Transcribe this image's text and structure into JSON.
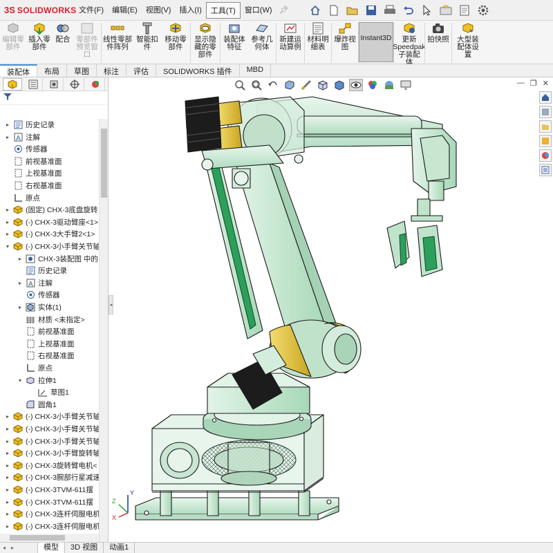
{
  "app": {
    "logo_ds": "3S",
    "logo_name": "SOLIDWORKS"
  },
  "menu": [
    "文件(F)",
    "编辑(E)",
    "视图(V)",
    "插入(I)",
    "工具(T)",
    "窗口(W)"
  ],
  "menu_active_index": 4,
  "ribbon": [
    {
      "label": "编辑零\n部件",
      "icon": "edit-component-icon",
      "disabled": true
    },
    {
      "label": "插入零\n部件",
      "icon": "insert-component-icon",
      "disabled": false
    },
    {
      "label": "配合",
      "icon": "mate-icon",
      "disabled": false
    },
    {
      "label": "零部件\n预览窗\n口",
      "icon": "component-preview-icon",
      "disabled": true
    },
    {
      "label": "线性零部\n件阵列",
      "icon": "linear-pattern-icon",
      "disabled": false
    },
    {
      "label": "智能扣\n件",
      "icon": "smart-fastener-icon",
      "disabled": false
    },
    {
      "label": "移动零\n部件",
      "icon": "move-component-icon",
      "disabled": false
    },
    {
      "label": "显示隐\n藏的零\n部件",
      "icon": "show-hidden-icon",
      "disabled": false
    },
    {
      "label": "装配体\n特征",
      "icon": "assembly-feature-icon",
      "disabled": false
    },
    {
      "label": "参考几\n何体",
      "icon": "reference-geometry-icon",
      "disabled": false
    },
    {
      "label": "新建运\n动算例",
      "icon": "motion-study-icon",
      "disabled": false
    },
    {
      "label": "材料明\n细表",
      "icon": "bom-icon",
      "disabled": false
    },
    {
      "label": "爆炸视\n图",
      "icon": "exploded-view-icon",
      "disabled": false
    },
    {
      "label": "Instant3D",
      "icon": "instant3d-icon",
      "disabled": false
    },
    {
      "label": "更新\nSpeedpak\n子装配\n体",
      "icon": "speedpak-icon",
      "disabled": false
    },
    {
      "label": "拍快照",
      "icon": "snapshot-icon",
      "disabled": false
    },
    {
      "label": "大型装\n配体设\n置",
      "icon": "large-assembly-icon",
      "disabled": false
    }
  ],
  "cm_tabs": [
    "装配体",
    "布局",
    "草图",
    "标注",
    "评估",
    "SOLIDWORKS 插件",
    "MBD"
  ],
  "cm_active_index": 0,
  "tree": [
    {
      "label": "历史记录",
      "icon": "history-icon",
      "exp": "▸",
      "indent": 0
    },
    {
      "label": "注解",
      "icon": "annotation-icon",
      "exp": "▸",
      "indent": 0
    },
    {
      "label": "传感器",
      "icon": "sensor-icon",
      "exp": "",
      "indent": 0
    },
    {
      "label": "前视基准面",
      "icon": "plane-icon",
      "exp": "",
      "indent": 0
    },
    {
      "label": "上视基准面",
      "icon": "plane-icon",
      "exp": "",
      "indent": 0
    },
    {
      "label": "右视基准面",
      "icon": "plane-icon",
      "exp": "",
      "indent": 0
    },
    {
      "label": "原点",
      "icon": "origin-icon",
      "exp": "",
      "indent": 0
    },
    {
      "label": "(固定) CHX-3底盘旋转",
      "icon": "part-icon",
      "exp": "▸",
      "indent": 0
    },
    {
      "label": "(-) CHX-3驱动臂座<1>",
      "icon": "part-icon",
      "exp": "▸",
      "indent": 0
    },
    {
      "label": "(-) CHX-3大手臂2<1>",
      "icon": "part-icon",
      "exp": "▸",
      "indent": 0
    },
    {
      "label": "(-) CHX-3小手臂关节轴",
      "icon": "part-icon",
      "exp": "▾",
      "indent": 0
    },
    {
      "label": "CHX-3装配图 中的",
      "icon": "assembly-icon",
      "exp": "▸",
      "indent": 1
    },
    {
      "label": "历史记录",
      "icon": "history-icon",
      "exp": "",
      "indent": 1
    },
    {
      "label": "注解",
      "icon": "annotation-icon",
      "exp": "▸",
      "indent": 1
    },
    {
      "label": "传感器",
      "icon": "sensor-icon",
      "exp": "",
      "indent": 1
    },
    {
      "label": "实体(1)",
      "icon": "solid-body-icon",
      "exp": "▸",
      "indent": 1
    },
    {
      "label": "材质 <未指定>",
      "icon": "material-icon",
      "exp": "",
      "indent": 1
    },
    {
      "label": "前视基准面",
      "icon": "plane-icon",
      "exp": "",
      "indent": 1
    },
    {
      "label": "上视基准面",
      "icon": "plane-icon",
      "exp": "",
      "indent": 1
    },
    {
      "label": "右视基准面",
      "icon": "plane-icon",
      "exp": "",
      "indent": 1
    },
    {
      "label": "原点",
      "icon": "origin-icon",
      "exp": "",
      "indent": 1
    },
    {
      "label": "拉伸1",
      "icon": "extrude-icon",
      "exp": "▾",
      "indent": 1
    },
    {
      "label": "草图1",
      "icon": "sketch-icon",
      "exp": "",
      "indent": 2
    },
    {
      "label": "圆角1",
      "icon": "fillet-icon",
      "exp": "",
      "indent": 1
    },
    {
      "label": "(-) CHX-3小手臂关节轴",
      "icon": "part-icon",
      "exp": "▸",
      "indent": 0
    },
    {
      "label": "(-) CHX-3小手臂关节轴",
      "icon": "part-icon",
      "exp": "▸",
      "indent": 0
    },
    {
      "label": "(-) CHX-3小手臂关节轴",
      "icon": "part-icon",
      "exp": "▸",
      "indent": 0
    },
    {
      "label": "(-) CHX-3小手臂旋转轴",
      "icon": "part-icon",
      "exp": "▸",
      "indent": 0
    },
    {
      "label": "(-) CHX-3旋转臂电机<",
      "icon": "part-icon",
      "exp": "▸",
      "indent": 0
    },
    {
      "label": "(-) CHX-3腕部行星减速",
      "icon": "part-icon",
      "exp": "▸",
      "indent": 0
    },
    {
      "label": "(-) CHX-3TVM-611摆",
      "icon": "part-icon",
      "exp": "▸",
      "indent": 0
    },
    {
      "label": "(-) CHX-3TVM-611摆",
      "icon": "part-icon",
      "exp": "▸",
      "indent": 0
    },
    {
      "label": "(-) CHX-3连杆伺服电机",
      "icon": "part-icon",
      "exp": "▸",
      "indent": 0
    },
    {
      "label": "(-) CHX-3连杆伺服电机",
      "icon": "part-icon",
      "exp": "▸",
      "indent": 0
    }
  ],
  "bottom_tabs": [
    "模型",
    "3D 视图",
    "动画1"
  ],
  "bottom_active_index": 0,
  "axes": {
    "x": "X",
    "y": "Y",
    "z": "Z"
  },
  "colors": {
    "part_green": "#c6e8d2",
    "accent_yellow": "#e6c230",
    "motor_black": "#1c1c1c",
    "edge": "#1a1a1a"
  }
}
